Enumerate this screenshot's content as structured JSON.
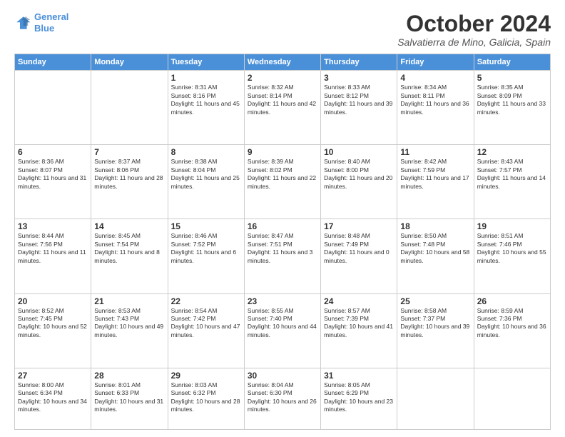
{
  "header": {
    "logo_line1": "General",
    "logo_line2": "Blue",
    "month_title": "October 2024",
    "location": "Salvatierra de Mino, Galicia, Spain"
  },
  "weekdays": [
    "Sunday",
    "Monday",
    "Tuesday",
    "Wednesday",
    "Thursday",
    "Friday",
    "Saturday"
  ],
  "weeks": [
    [
      {
        "day": "",
        "info": ""
      },
      {
        "day": "",
        "info": ""
      },
      {
        "day": "1",
        "info": "Sunrise: 8:31 AM\nSunset: 8:16 PM\nDaylight: 11 hours and 45 minutes."
      },
      {
        "day": "2",
        "info": "Sunrise: 8:32 AM\nSunset: 8:14 PM\nDaylight: 11 hours and 42 minutes."
      },
      {
        "day": "3",
        "info": "Sunrise: 8:33 AM\nSunset: 8:12 PM\nDaylight: 11 hours and 39 minutes."
      },
      {
        "day": "4",
        "info": "Sunrise: 8:34 AM\nSunset: 8:11 PM\nDaylight: 11 hours and 36 minutes."
      },
      {
        "day": "5",
        "info": "Sunrise: 8:35 AM\nSunset: 8:09 PM\nDaylight: 11 hours and 33 minutes."
      }
    ],
    [
      {
        "day": "6",
        "info": "Sunrise: 8:36 AM\nSunset: 8:07 PM\nDaylight: 11 hours and 31 minutes."
      },
      {
        "day": "7",
        "info": "Sunrise: 8:37 AM\nSunset: 8:06 PM\nDaylight: 11 hours and 28 minutes."
      },
      {
        "day": "8",
        "info": "Sunrise: 8:38 AM\nSunset: 8:04 PM\nDaylight: 11 hours and 25 minutes."
      },
      {
        "day": "9",
        "info": "Sunrise: 8:39 AM\nSunset: 8:02 PM\nDaylight: 11 hours and 22 minutes."
      },
      {
        "day": "10",
        "info": "Sunrise: 8:40 AM\nSunset: 8:00 PM\nDaylight: 11 hours and 20 minutes."
      },
      {
        "day": "11",
        "info": "Sunrise: 8:42 AM\nSunset: 7:59 PM\nDaylight: 11 hours and 17 minutes."
      },
      {
        "day": "12",
        "info": "Sunrise: 8:43 AM\nSunset: 7:57 PM\nDaylight: 11 hours and 14 minutes."
      }
    ],
    [
      {
        "day": "13",
        "info": "Sunrise: 8:44 AM\nSunset: 7:56 PM\nDaylight: 11 hours and 11 minutes."
      },
      {
        "day": "14",
        "info": "Sunrise: 8:45 AM\nSunset: 7:54 PM\nDaylight: 11 hours and 8 minutes."
      },
      {
        "day": "15",
        "info": "Sunrise: 8:46 AM\nSunset: 7:52 PM\nDaylight: 11 hours and 6 minutes."
      },
      {
        "day": "16",
        "info": "Sunrise: 8:47 AM\nSunset: 7:51 PM\nDaylight: 11 hours and 3 minutes."
      },
      {
        "day": "17",
        "info": "Sunrise: 8:48 AM\nSunset: 7:49 PM\nDaylight: 11 hours and 0 minutes."
      },
      {
        "day": "18",
        "info": "Sunrise: 8:50 AM\nSunset: 7:48 PM\nDaylight: 10 hours and 58 minutes."
      },
      {
        "day": "19",
        "info": "Sunrise: 8:51 AM\nSunset: 7:46 PM\nDaylight: 10 hours and 55 minutes."
      }
    ],
    [
      {
        "day": "20",
        "info": "Sunrise: 8:52 AM\nSunset: 7:45 PM\nDaylight: 10 hours and 52 minutes."
      },
      {
        "day": "21",
        "info": "Sunrise: 8:53 AM\nSunset: 7:43 PM\nDaylight: 10 hours and 49 minutes."
      },
      {
        "day": "22",
        "info": "Sunrise: 8:54 AM\nSunset: 7:42 PM\nDaylight: 10 hours and 47 minutes."
      },
      {
        "day": "23",
        "info": "Sunrise: 8:55 AM\nSunset: 7:40 PM\nDaylight: 10 hours and 44 minutes."
      },
      {
        "day": "24",
        "info": "Sunrise: 8:57 AM\nSunset: 7:39 PM\nDaylight: 10 hours and 41 minutes."
      },
      {
        "day": "25",
        "info": "Sunrise: 8:58 AM\nSunset: 7:37 PM\nDaylight: 10 hours and 39 minutes."
      },
      {
        "day": "26",
        "info": "Sunrise: 8:59 AM\nSunset: 7:36 PM\nDaylight: 10 hours and 36 minutes."
      }
    ],
    [
      {
        "day": "27",
        "info": "Sunrise: 8:00 AM\nSunset: 6:34 PM\nDaylight: 10 hours and 34 minutes."
      },
      {
        "day": "28",
        "info": "Sunrise: 8:01 AM\nSunset: 6:33 PM\nDaylight: 10 hours and 31 minutes."
      },
      {
        "day": "29",
        "info": "Sunrise: 8:03 AM\nSunset: 6:32 PM\nDaylight: 10 hours and 28 minutes."
      },
      {
        "day": "30",
        "info": "Sunrise: 8:04 AM\nSunset: 6:30 PM\nDaylight: 10 hours and 26 minutes."
      },
      {
        "day": "31",
        "info": "Sunrise: 8:05 AM\nSunset: 6:29 PM\nDaylight: 10 hours and 23 minutes."
      },
      {
        "day": "",
        "info": ""
      },
      {
        "day": "",
        "info": ""
      }
    ]
  ]
}
